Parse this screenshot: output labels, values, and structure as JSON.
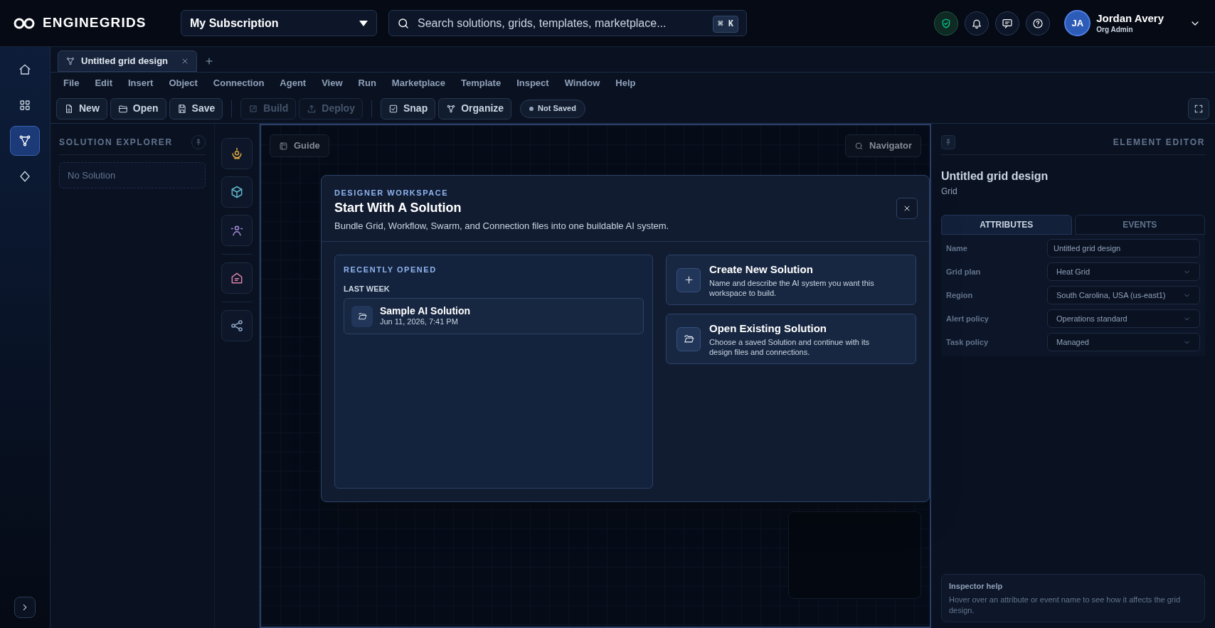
{
  "brand": {
    "name": "ENGINEGRIDS"
  },
  "subscription": {
    "value": "My Subscription"
  },
  "search": {
    "placeholder": "Search solutions, grids, templates, marketplace...",
    "shortcut": "⌘ K"
  },
  "header_actions": [
    {
      "kind": "shield"
    },
    {
      "kind": "bell"
    },
    {
      "kind": "message"
    },
    {
      "kind": "help"
    }
  ],
  "user": {
    "initials": "JA",
    "name": "Jordan Avery",
    "role": "Org Admin"
  },
  "rail": {
    "items": [
      {
        "kind": "home",
        "selected": false
      },
      {
        "kind": "grid",
        "selected": false
      },
      {
        "kind": "nodes",
        "selected": true
      },
      {
        "kind": "diamond",
        "selected": false
      }
    ]
  },
  "document_tabs": [
    {
      "label": "Untitled grid design",
      "selected": true
    }
  ],
  "menu": [
    "File",
    "Edit",
    "Insert",
    "Object",
    "Connection",
    "Agent",
    "View",
    "Run",
    "Marketplace",
    "Template",
    "Inspect",
    "Window",
    "Help"
  ],
  "toolbar": {
    "groups": [
      {
        "buttons": [
          {
            "label": "New",
            "disabled": false
          },
          {
            "label": "Open",
            "disabled": false
          },
          {
            "label": "Save",
            "disabled": false
          }
        ]
      },
      {
        "buttons": [
          {
            "label": "Build",
            "disabled": true
          },
          {
            "label": "Deploy",
            "disabled": true
          }
        ]
      },
      {
        "buttons": [
          {
            "label": "Snap",
            "disabled": false
          },
          {
            "label": "Organize",
            "disabled": false
          }
        ]
      }
    ],
    "status": "Not Saved"
  },
  "explorer": {
    "title": "SOLUTION EXPLORER",
    "empty": "No Solution"
  },
  "palette": [
    {
      "kind": "beacon"
    },
    {
      "kind": "cube"
    },
    {
      "kind": "person"
    },
    {
      "kind": "storage"
    },
    {
      "kind": "share"
    }
  ],
  "canvas": {
    "guide": "Guide",
    "navigator": "Navigator"
  },
  "modal": {
    "eyebrow": "DESIGNER WORKSPACE",
    "title": "Start With A Solution",
    "subtitle": "Bundle Grid, Workflow, Swarm, and Connection files into one buildable AI system.",
    "recent": {
      "title": "RECENTLY OPENED",
      "groups": [
        {
          "label": "LAST WEEK",
          "items": [
            {
              "name": "Sample AI Solution",
              "date": "Jun 11, 2026, 7:41 PM"
            }
          ]
        }
      ]
    },
    "actions": [
      {
        "kind": "create",
        "title": "Create New Solution",
        "description": "Name and describe the AI system you want this workspace to build."
      },
      {
        "kind": "open",
        "title": "Open Existing Solution",
        "description": "Choose a saved Solution and continue with its design files and connections."
      }
    ]
  },
  "inspector": {
    "title": "ELEMENT EDITOR",
    "element_name": "Untitled grid design",
    "element_type": "Grid",
    "tabs": [
      {
        "label": "ATTRIBUTES",
        "selected": true
      },
      {
        "label": "EVENTS",
        "selected": false
      }
    ],
    "fields": [
      {
        "label": "Name",
        "kind": "text",
        "value": "Untitled grid design"
      },
      {
        "label": "Grid plan",
        "kind": "select",
        "value": "Heat Grid"
      },
      {
        "label": "Region",
        "kind": "select",
        "value": "South Carolina, USA (us-east1)"
      },
      {
        "label": "Alert policy",
        "kind": "select",
        "value": "Operations standard"
      },
      {
        "label": "Task policy",
        "kind": "select",
        "value": "Managed"
      }
    ],
    "help": {
      "title": "Inspector help",
      "text": "Hover over an attribute or event name to see how it affects the grid design."
    }
  }
}
